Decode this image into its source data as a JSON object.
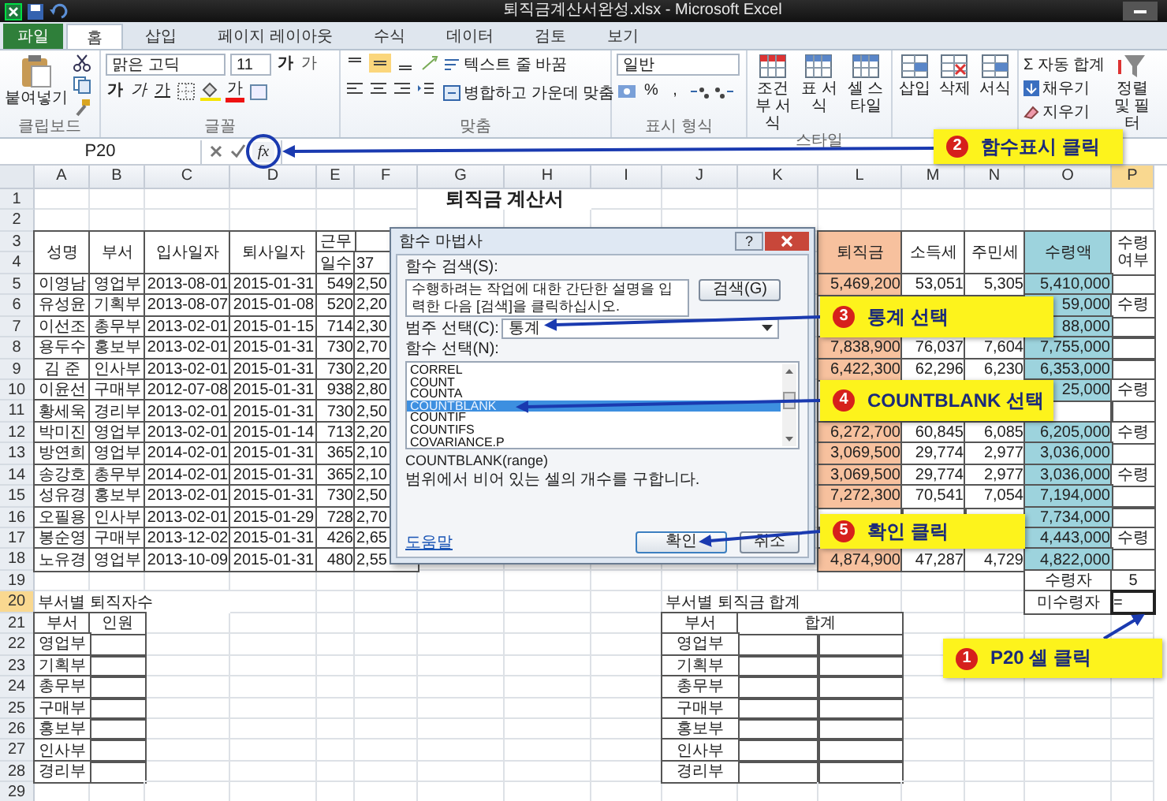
{
  "window": {
    "title": "퇴직금계산서완성.xlsx - Microsoft Excel"
  },
  "tabs": [
    {
      "label": "파일",
      "kind": "file",
      "selected": false
    },
    {
      "label": "홈",
      "kind": "tab",
      "selected": true
    },
    {
      "label": "삽입",
      "kind": "tab",
      "selected": false
    },
    {
      "label": "페이지 레이아웃",
      "kind": "tab",
      "selected": false
    },
    {
      "label": "수식",
      "kind": "tab",
      "selected": false
    },
    {
      "label": "데이터",
      "kind": "tab",
      "selected": false
    },
    {
      "label": "검토",
      "kind": "tab",
      "selected": false
    },
    {
      "label": "보기",
      "kind": "tab",
      "selected": false
    }
  ],
  "ribbon": {
    "clipboard": {
      "label": "클립보드",
      "paste": "붙여넣기"
    },
    "font": {
      "label": "글꼴",
      "family": "맑은 고딕",
      "size": "11",
      "grow": "가",
      "shrink": "가",
      "bold": "가",
      "italic": "가",
      "underline": "가",
      "font_color_button": "가"
    },
    "alignment": {
      "label": "맞춤",
      "wrap": "텍스트 줄 바꿈",
      "merge": "병합하고 가운데 맞춤"
    },
    "number": {
      "label": "표시 형식",
      "format": "일반",
      "percent": "%",
      "comma": ","
    },
    "styles": {
      "label": "스타일",
      "buttons": [
        "조건부 서식",
        "표 서식",
        "셀 스타일"
      ]
    },
    "cells": {
      "buttons": [
        "삽입",
        "삭제",
        "서식"
      ]
    },
    "editing": {
      "autosum": "Σ 자동 합계",
      "fill": "채우기",
      "clear": "지우기",
      "sort": "정렬 및 필터"
    }
  },
  "formula_bar": {
    "name_box": "P20",
    "fx": "fx"
  },
  "sheet": {
    "columns": [
      {
        "label": "A",
        "selected": false
      },
      {
        "label": "B",
        "selected": false
      },
      {
        "label": "C",
        "selected": false
      },
      {
        "label": "D",
        "selected": false
      },
      {
        "label": "E",
        "selected": false
      },
      {
        "label": "F",
        "selected": false
      },
      {
        "label": "G",
        "selected": false
      },
      {
        "label": "H",
        "selected": false
      },
      {
        "label": "I",
        "selected": false
      },
      {
        "label": "J",
        "selected": false
      },
      {
        "label": "K",
        "selected": false
      },
      {
        "label": "L",
        "selected": false
      },
      {
        "label": "M",
        "selected": false
      },
      {
        "label": "N",
        "selected": false
      },
      {
        "label": "O",
        "selected": false
      },
      {
        "label": "P",
        "selected": true
      }
    ],
    "rows": [
      {
        "label": "1",
        "selected": false,
        "cells": [
          "",
          "",
          "",
          "",
          "",
          "",
          "퇴직금 계산서"
        ]
      },
      {
        "label": "2",
        "selected": false,
        "cells": []
      },
      {
        "label": "3",
        "selected": false,
        "cells": [
          "성명",
          "부서",
          "입사일자",
          "퇴사일자",
          "근무",
          "",
          "",
          "",
          "",
          "",
          "",
          "퇴직금",
          "소득세",
          "주민세",
          "수령액",
          "수령 여부"
        ]
      },
      {
        "label": "4",
        "selected": false,
        "cells": [
          "",
          "",
          "",
          "",
          "일수",
          "37"
        ]
      },
      {
        "label": "5",
        "selected": false,
        "cells": [
          "이영남",
          "영업부",
          "2013-08-01",
          "2015-01-31",
          "549",
          "2,50",
          "",
          "",
          "",
          "",
          "",
          "5,469,200",
          "53,051",
          "5,305",
          "5,410,000"
        ]
      },
      {
        "label": "6",
        "selected": false,
        "cells": [
          "유성윤",
          "기획부",
          "2013-08-07",
          "2015-01-08",
          "520",
          "2,20",
          "",
          "",
          "",
          "",
          "",
          "",
          "",
          "",
          "59,000",
          "수령"
        ]
      },
      {
        "label": "7",
        "selected": false,
        "cells": [
          "이선조",
          "총무부",
          "2013-02-01",
          "2015-01-15",
          "714",
          "2,30",
          "",
          "",
          "",
          "",
          "",
          "",
          "",
          "",
          "88,000"
        ]
      },
      {
        "label": "8",
        "selected": false,
        "cells": [
          "용두수",
          "홍보부",
          "2013-02-01",
          "2015-01-31",
          "730",
          "2,70",
          "",
          "",
          "",
          "",
          "",
          "7,838,900",
          "76,037",
          "7,604",
          "7,755,000"
        ]
      },
      {
        "label": "9",
        "selected": false,
        "cells": [
          "김 준",
          "인사부",
          "2013-02-01",
          "2015-01-31",
          "730",
          "2,20",
          "",
          "",
          "",
          "",
          "",
          "6,422,300",
          "62,296",
          "6,230",
          "6,353,000"
        ]
      },
      {
        "label": "10",
        "selected": false,
        "cells": [
          "이윤선",
          "구매부",
          "2012-07-08",
          "2015-01-31",
          "938",
          "2,80",
          "",
          "",
          "",
          "",
          "",
          "",
          "",
          "",
          "25,000",
          "수령"
        ]
      },
      {
        "label": "11",
        "selected": false,
        "cells": [
          "황세욱",
          "경리부",
          "2013-02-01",
          "2015-01-31",
          "730",
          "2,50"
        ]
      },
      {
        "label": "12",
        "selected": false,
        "cells": [
          "박미진",
          "영업부",
          "2013-02-01",
          "2015-01-14",
          "713",
          "2,20",
          "",
          "",
          "",
          "",
          "",
          "6,272,700",
          "60,845",
          "6,085",
          "6,205,000",
          "수령"
        ]
      },
      {
        "label": "13",
        "selected": false,
        "cells": [
          "방연희",
          "영업부",
          "2014-02-01",
          "2015-01-31",
          "365",
          "2,10",
          "",
          "",
          "",
          "",
          "",
          "3,069,500",
          "29,774",
          "2,977",
          "3,036,000"
        ]
      },
      {
        "label": "14",
        "selected": false,
        "cells": [
          "송강호",
          "총무부",
          "2014-02-01",
          "2015-01-31",
          "365",
          "2,10",
          "",
          "",
          "",
          "",
          "",
          "3,069,500",
          "29,774",
          "2,977",
          "3,036,000",
          "수령"
        ]
      },
      {
        "label": "15",
        "selected": false,
        "cells": [
          "성유경",
          "홍보부",
          "2013-02-01",
          "2015-01-31",
          "730",
          "2,50",
          "",
          "",
          "",
          "",
          "",
          "7,272,300",
          "70,541",
          "7,054",
          "7,194,000"
        ]
      },
      {
        "label": "16",
        "selected": false,
        "cells": [
          "오필용",
          "인사부",
          "2013-02-01",
          "2015-01-29",
          "728",
          "2,70",
          "",
          "",
          "",
          "",
          "",
          "",
          "",
          "",
          "7,734,000"
        ]
      },
      {
        "label": "17",
        "selected": false,
        "cells": [
          "봉순영",
          "구매부",
          "2013-12-02",
          "2015-01-31",
          "426",
          "2,65",
          "",
          "",
          "",
          "",
          "",
          "",
          "",
          "",
          "4,443,000",
          "수령"
        ]
      },
      {
        "label": "18",
        "selected": false,
        "cells": [
          "노유경",
          "영업부",
          "2013-10-09",
          "2015-01-31",
          "480",
          "2,55",
          "",
          "",
          "",
          "",
          "",
          "4,874,900",
          "47,287",
          "4,729",
          "4,822,000"
        ]
      },
      {
        "label": "19",
        "selected": false,
        "cells": [
          "",
          "",
          "",
          "",
          "",
          "",
          "",
          "",
          "",
          "",
          "",
          "",
          "",
          "",
          "수령자",
          "5"
        ]
      },
      {
        "label": "20",
        "selected": true,
        "cells": [
          "부서별 퇴직자수",
          "",
          "",
          "",
          "",
          "",
          "",
          "",
          "",
          "부서별 퇴직금 합계",
          "",
          "",
          "",
          "",
          "미수령자",
          "="
        ]
      },
      {
        "label": "21",
        "selected": false,
        "cells": [
          "부서",
          "인원",
          "",
          "",
          "",
          "",
          "",
          "",
          "",
          "부서",
          "합계"
        ]
      },
      {
        "label": "22",
        "selected": false,
        "cells": [
          "영업부",
          "",
          "",
          "",
          "",
          "",
          "",
          "",
          "",
          "영업부"
        ]
      },
      {
        "label": "23",
        "selected": false,
        "cells": [
          "기획부",
          "",
          "",
          "",
          "",
          "",
          "",
          "",
          "",
          "기획부"
        ]
      },
      {
        "label": "24",
        "selected": false,
        "cells": [
          "총무부",
          "",
          "",
          "",
          "",
          "",
          "",
          "",
          "",
          "총무부"
        ]
      },
      {
        "label": "25",
        "selected": false,
        "cells": [
          "구매부",
          "",
          "",
          "",
          "",
          "",
          "",
          "",
          "",
          "구매부"
        ]
      },
      {
        "label": "26",
        "selected": false,
        "cells": [
          "홍보부",
          "",
          "",
          "",
          "",
          "",
          "",
          "",
          "",
          "홍보부"
        ]
      },
      {
        "label": "27",
        "selected": false,
        "cells": [
          "인사부",
          "",
          "",
          "",
          "",
          "",
          "",
          "",
          "",
          "인사부"
        ]
      },
      {
        "label": "28",
        "selected": false,
        "cells": [
          "경리부",
          "",
          "",
          "",
          "",
          "",
          "",
          "",
          "",
          "경리부"
        ]
      },
      {
        "label": "29",
        "selected": false,
        "cells": []
      }
    ]
  },
  "dialog": {
    "title": "함수 마법사",
    "help": "?",
    "search_label": "함수 검색(S):",
    "search_value": "수행하려는 작업에 대한 간단한 설명을 입력한 다음 [검색]을 클릭하십시오.",
    "search_button": "검색(G)",
    "category_label": "범주 선택(C):",
    "category_value": "통계",
    "function_label": "함수 선택(N):",
    "functions": [
      {
        "name": "CORREL",
        "selected": false
      },
      {
        "name": "COUNT",
        "selected": false
      },
      {
        "name": "COUNTA",
        "selected": false
      },
      {
        "name": "COUNTBLANK",
        "selected": true
      },
      {
        "name": "COUNTIF",
        "selected": false
      },
      {
        "name": "COUNTIFS",
        "selected": false
      },
      {
        "name": "COVARIANCE.P",
        "selected": false
      }
    ],
    "signature": "COUNTBLANK(range)",
    "description": "범위에서 비어 있는 셀의 개수를 구합니다.",
    "help_link": "도움말",
    "ok": "확인",
    "cancel": "취소"
  },
  "callouts": [
    {
      "number": "2",
      "text": "함수표시 클릭"
    },
    {
      "number": "3",
      "text": "통계 선택"
    },
    {
      "number": "4",
      "text": "COUNTBLANK 선택"
    },
    {
      "number": "5",
      "text": "확인 클릭"
    },
    {
      "number": "1",
      "text": "P20 셀 클릭"
    }
  ]
}
